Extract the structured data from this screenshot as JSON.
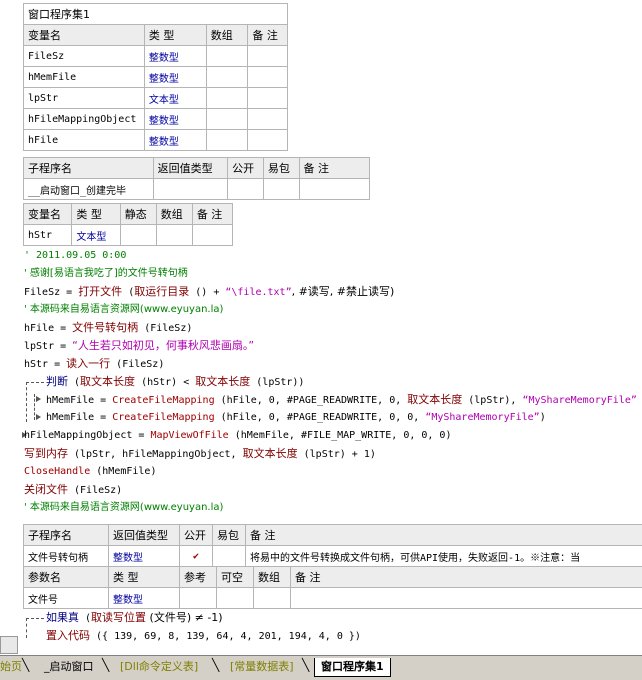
{
  "set_table": {
    "title": "窗口程序集1",
    "headers": [
      "变量名",
      "类 型",
      "数组",
      "备 注"
    ],
    "rows": [
      [
        "FileSz",
        "整数型"
      ],
      [
        "hMemFile",
        "整数型"
      ],
      [
        "lpStr",
        "文本型"
      ],
      [
        "hFileMappingObject",
        "整数型"
      ],
      [
        "hFile",
        "整数型"
      ]
    ]
  },
  "sub1_table": {
    "headers": [
      "子程序名",
      "返回值类型",
      "公开",
      "易包",
      "备 注"
    ],
    "name": "__启动窗口_创建完毕"
  },
  "local1_table": {
    "headers": [
      "变量名",
      "类 型",
      "静态",
      "数组",
      "备 注"
    ],
    "rows": [
      [
        "hStr",
        "文本型"
      ]
    ]
  },
  "code": {
    "l1": "' 2011.09.05 0:00",
    "l2": "' 感谢[易语言我吃了]的文件号转句柄",
    "l3a": "FileSz = ",
    "l3b": "打开文件",
    "l3c": " (",
    "l3d": "取运行目录",
    "l3e": " () + ",
    "l3f": "“\\file.txt”",
    "l3g": ", #读写, #禁止读写)",
    "l4": "' 本源码来自易语言资源网(www.eyuyan.la)",
    "l5a": "hFile = ",
    "l5b": "文件号转句柄",
    "l5c": " (FileSz)",
    "l6a": "lpStr = ",
    "l6b": "“人生若只如初见，何事秋风悲画扇。”",
    "l7a": "hStr = ",
    "l7b": "读入一行",
    "l7c": " (FileSz)",
    "l8a": "判断",
    "l8b": " (",
    "l8c": "取文本长度",
    "l8d": " (hStr) < ",
    "l8e": "取文本长度",
    "l8f": " (lpStr))",
    "l9a": "hMemFile = ",
    "l9b": "CreateFileMapping",
    "l9c": " (hFile, 0, #PAGE_READWRITE, 0, ",
    "l9d": "取文本长度",
    "l9e": " (lpStr), ",
    "l9f": "“MyShareMemoryFile”",
    "l10a": "hMemFile = ",
    "l10b": "CreateFileMapping",
    "l10c": " (hFile, 0, #PAGE_READWRITE, 0, 0, ",
    "l10d": "“MyShareMemoryFile”",
    "l10e": ")",
    "l11a": "hFileMappingObject = ",
    "l11b": "MapViewOfFile",
    "l11c": " (hMemFile, #FILE_MAP_WRITE, 0, 0, 0)",
    "l12a": "写到内存",
    "l12b": " (lpStr, hFileMappingObject, ",
    "l12c": "取文本长度",
    "l12d": " (lpStr) + 1)",
    "l13a": "CloseHandle",
    "l13b": " (hMemFile)",
    "l14a": "关闭文件",
    "l14b": " (FileSz)",
    "l15": "' 本源码来自易语言资源网(www.eyuyan.la)"
  },
  "sub2_table": {
    "headers": [
      "子程序名",
      "返回值类型",
      "公开",
      "易包",
      "备 注"
    ],
    "name": "文件号转句柄",
    "ret": "整数型",
    "public_mark": "✔",
    "remark": "将易中的文件号转换成文件句柄，可供API使用，失败返回-1。※注意：当"
  },
  "param_table": {
    "headers": [
      "参数名",
      "类 型",
      "参考",
      "可空",
      "数组",
      "备 注"
    ],
    "rows": [
      [
        "文件号",
        "整数型"
      ]
    ]
  },
  "code2": {
    "l1a": "如果真",
    "l1b": " (",
    "l1c": "取读写位置",
    "l1d": " (文件号) ≠ -1)",
    "l2a": "置入代码",
    "l2b": " ({ 139, 69, 8, 139, 64, 4, 201, 194, 4, 0 })"
  },
  "tabs": [
    "始页",
    "_启动窗口",
    "[Dll命令定义表]",
    "[常量数据表]",
    "窗口程序集1"
  ]
}
